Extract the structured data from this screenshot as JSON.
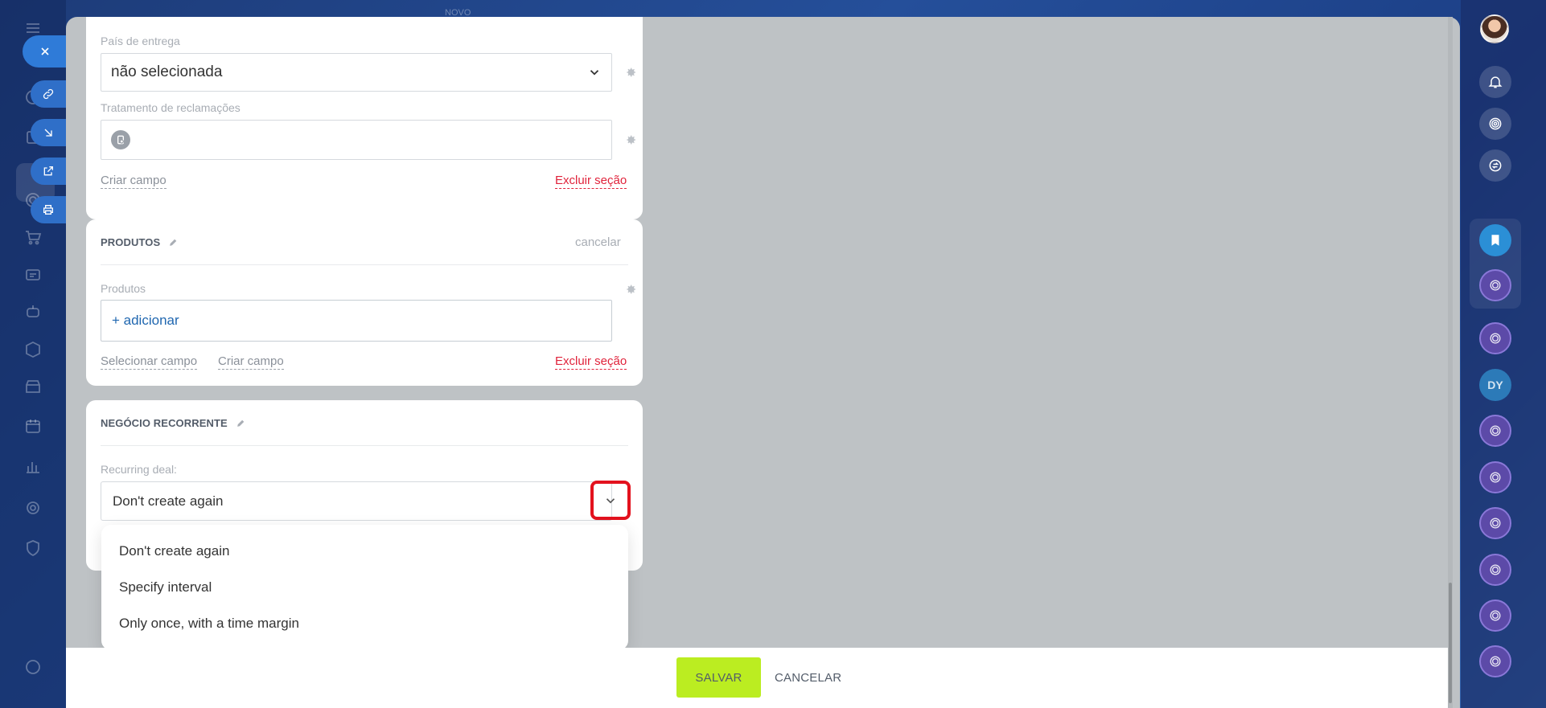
{
  "header": {
    "behind_label": "NOVO"
  },
  "form": {
    "delivery_country": {
      "label": "País de entrega",
      "value": "não selecionada"
    },
    "complaints": {
      "label": "Tratamento de reclamações",
      "value": ""
    },
    "section1_links": {
      "create_field": "Criar campo",
      "delete_section": "Excluir seção"
    },
    "products_section": {
      "title": "PRODUTOS",
      "cancel": "cancelar",
      "field_label": "Produtos",
      "add": "+ adicionar",
      "select_field": "Selecionar campo",
      "create_field": "Criar campo",
      "delete_section": "Excluir seção"
    },
    "recurring_section": {
      "title": "NEGÓCIO RECORRENTE",
      "field_label": "Recurring deal:",
      "value": "Don't create again",
      "options": [
        "Don't create again",
        "Specify interval",
        "Only once, with a time margin"
      ]
    }
  },
  "footer": {
    "save": "SALVAR",
    "cancel": "CANCELAR"
  },
  "right_nav": {
    "user_initials": "DY"
  },
  "colors": {
    "save_button": "#bbed21",
    "danger_link": "#e0233b",
    "highlight": "#e3121e",
    "link_blue": "#2067b0"
  }
}
